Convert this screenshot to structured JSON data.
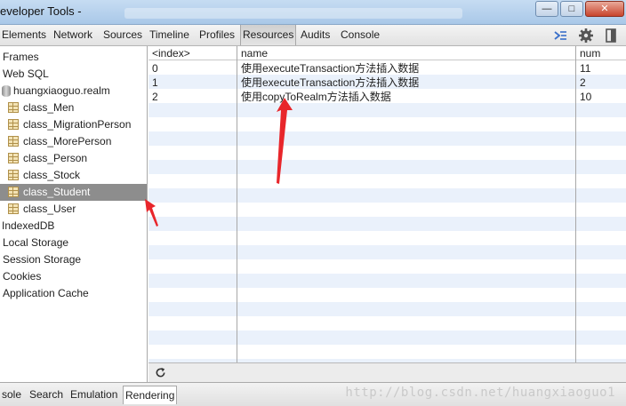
{
  "window": {
    "title": "eveloper Tools -",
    "buttons": {
      "minimize": "—",
      "maximize": "□",
      "close": "✕"
    }
  },
  "toolbar": {
    "tabs": [
      {
        "label": "Elements"
      },
      {
        "label": "Network"
      },
      {
        "label": "Sources"
      },
      {
        "label": "Timeline"
      },
      {
        "label": "Profiles"
      },
      {
        "label": "Resources"
      },
      {
        "label": "Audits"
      },
      {
        "label": "Console"
      }
    ],
    "selected": "Resources"
  },
  "sidebar": {
    "items": [
      {
        "label": "Frames"
      },
      {
        "label": "Web SQL"
      },
      {
        "label": "huangxiaoguo.realm"
      },
      {
        "label": "class_Men"
      },
      {
        "label": "class_MigrationPerson"
      },
      {
        "label": "class_MorePerson"
      },
      {
        "label": "class_Person"
      },
      {
        "label": "class_Stock"
      },
      {
        "label": "class_Student"
      },
      {
        "label": "class_User"
      },
      {
        "label": "IndexedDB"
      },
      {
        "label": "Local Storage"
      },
      {
        "label": "Session Storage"
      },
      {
        "label": "Cookies"
      },
      {
        "label": "Application Cache"
      }
    ],
    "selected": "class_Student"
  },
  "table": {
    "columns": [
      "<index>",
      "name",
      "num"
    ],
    "rows": [
      [
        "0",
        "使用executeTransaction方法插入数据",
        "11"
      ],
      [
        "1",
        "使用executeTransaction方法插入数据",
        "2"
      ],
      [
        "2",
        "使用copyToRealm方法插入数据",
        "10"
      ]
    ]
  },
  "bottom_tabs": {
    "tabs": [
      {
        "label": "sole"
      },
      {
        "label": "Search"
      },
      {
        "label": "Emulation"
      },
      {
        "label": "Rendering"
      }
    ],
    "selected": "Rendering"
  },
  "watermark": "http://blog.csdn.net/huangxiaoguo1",
  "colors": {
    "annotation_arrow": "#e8262b",
    "selected_item": "#8d8d8d",
    "stripe": "#eaf1fb"
  }
}
